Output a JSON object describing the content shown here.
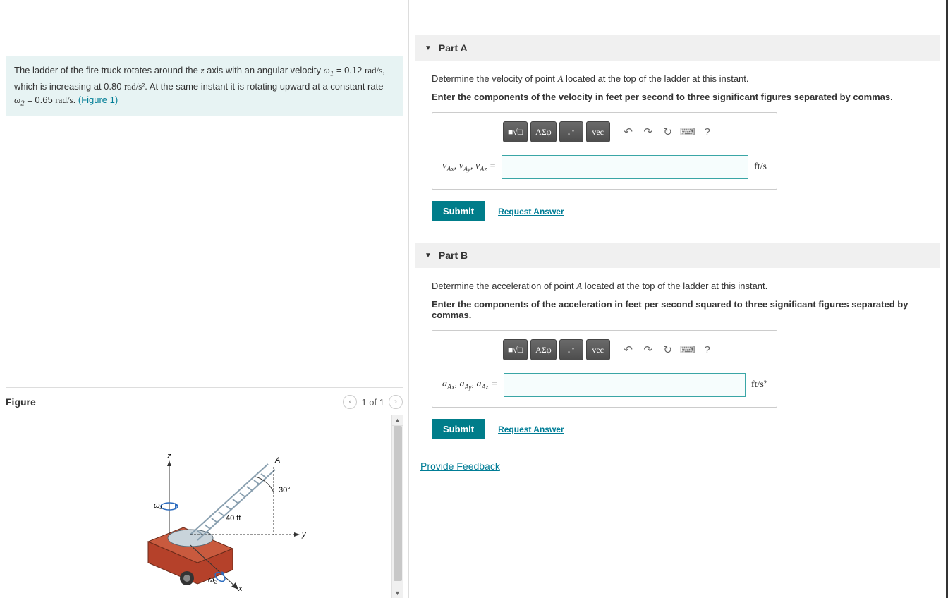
{
  "problem": {
    "text_prefix": "The ladder of the fire truck rotates around the ",
    "axis_var": "z",
    "text_mid1": " axis with an angular velocity ",
    "omega1_sym": "ω",
    "omega1_sub": "1",
    "text_eq1": " = 0.12 ",
    "unit_rads": "rad/s",
    "text_mid2": ", which is increasing at 0.80 ",
    "unit_rads2": "rad/s²",
    "text_mid3": ". At the same instant it is rotating upward at a constant rate ",
    "omega2_sub": "2",
    "text_eq2": " = 0.65 ",
    "text_end": ". ",
    "figure_link": "(Figure 1)"
  },
  "figure": {
    "title": "Figure",
    "count": "1 of 1",
    "labels": {
      "z": "z",
      "y": "y",
      "x": "x",
      "A": "A",
      "angle": "30°",
      "length": "40 ft",
      "w1": "ω₁",
      "w2": "ω₂"
    }
  },
  "partA": {
    "title": "Part A",
    "prompt_pre": "Determine the velocity of point ",
    "point": "A",
    "prompt_post": " located at the top of the ladder at this instant.",
    "instruction": "Enter the components of the velocity in feet per second to three significant figures separated by commas.",
    "vars_html": "v_Ax, v_Ay, v_Az =",
    "unit": "ft/s",
    "submit": "Submit",
    "request": "Request Answer"
  },
  "partB": {
    "title": "Part B",
    "prompt_pre": "Determine the acceleration of point ",
    "point": "A",
    "prompt_post": " located at the top of the ladder at this instant.",
    "instruction": "Enter the components of the acceleration in feet per second squared to three significant figures separated by commas.",
    "vars_html": "a_Ax, a_Ay, a_Az =",
    "unit": "ft/s²",
    "submit": "Submit",
    "request": "Request Answer"
  },
  "toolbar": {
    "template": "■√□",
    "greek": "ΑΣφ",
    "subsup": "↓↑",
    "vec": "vec",
    "undo": "↶",
    "redo": "↷",
    "reset": "↻",
    "keyboard": "⌨",
    "help": "?"
  },
  "feedback": "Provide Feedback"
}
